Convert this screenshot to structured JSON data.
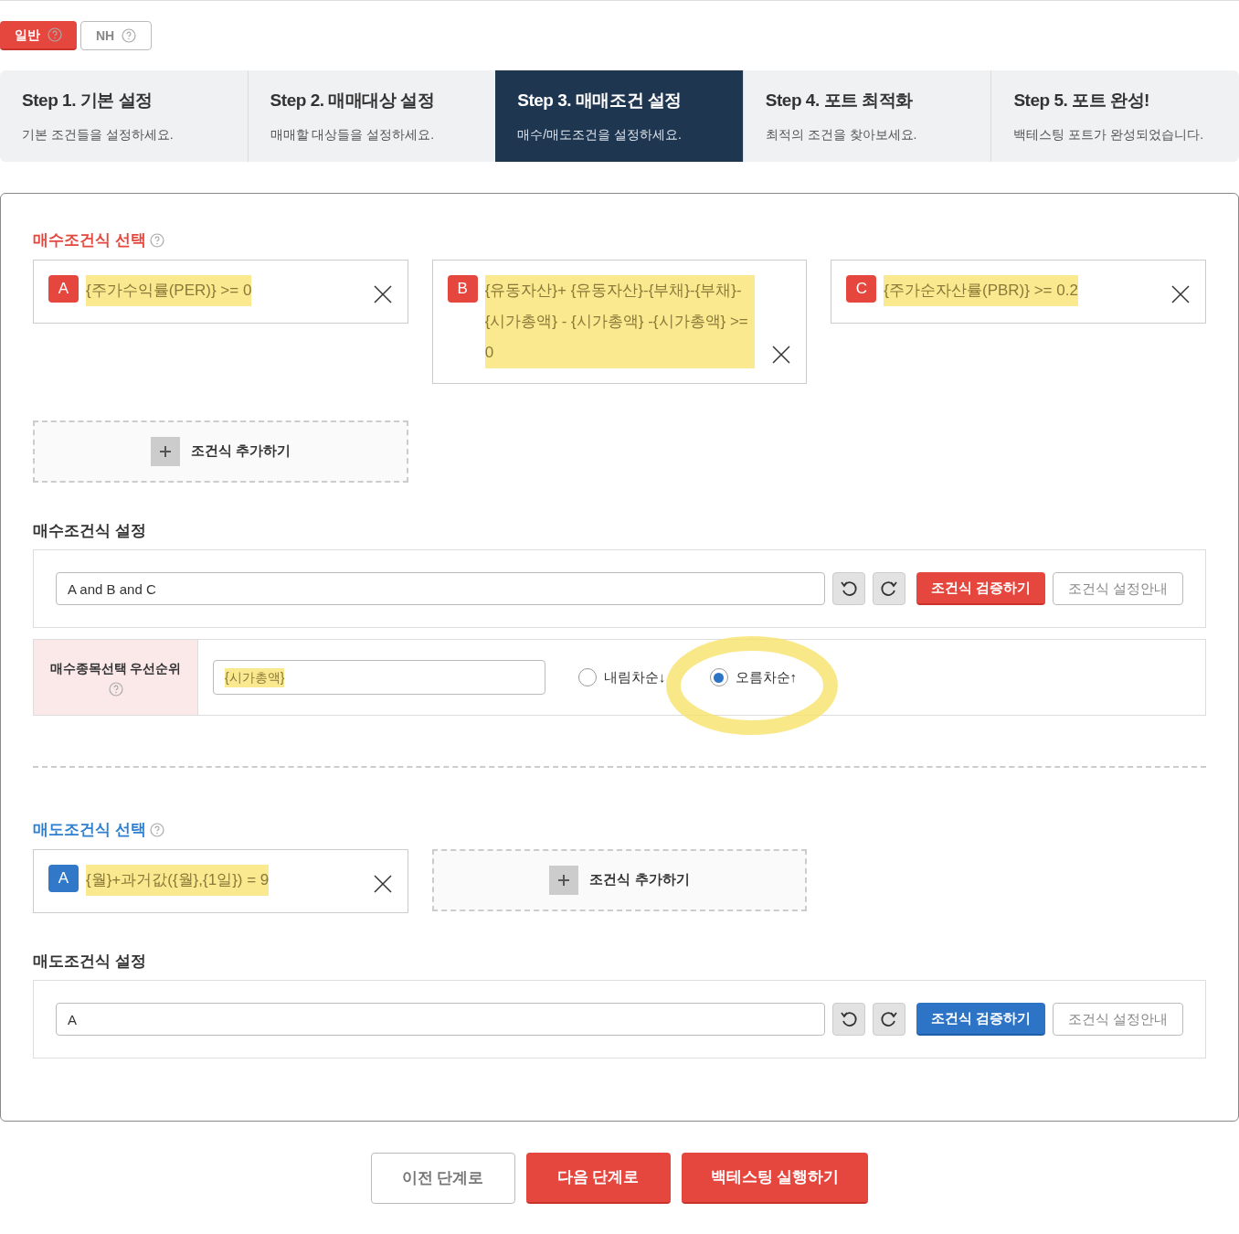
{
  "modes": [
    {
      "label": "일반",
      "selected": true
    },
    {
      "label": "NH",
      "selected": false
    }
  ],
  "steps": [
    {
      "title": "Step 1. 기본 설정",
      "subtitle": "기본 조건들을 설정하세요.",
      "selected": false
    },
    {
      "title": "Step 2. 매매대상 설정",
      "subtitle": "매매할 대상들을 설정하세요.",
      "selected": false
    },
    {
      "title": "Step 3. 매매조건 설정",
      "subtitle": "매수/매도조건을 설정하세요.",
      "selected": true
    },
    {
      "title": "Step 4. 포트 최적화",
      "subtitle": "최적의 조건을 찾아보세요.",
      "selected": false
    },
    {
      "title": "Step 5. 포트 완성!",
      "subtitle": "백테스팅 포트가 완성되었습니다.",
      "selected": false
    }
  ],
  "sections": [
    {
      "kind": "buy",
      "title": "매수조건식 선택",
      "conditions": [
        {
          "letter": "A",
          "formula": "{주가수익률(PER)} >= 0",
          "highlighted": true
        },
        {
          "letter": "B",
          "formula": "{유동자산}+ {유동자산}-{부채}-{부채}-{시가총액} - {시가총액} -{시가총액} >= 0",
          "highlighted": true
        },
        {
          "letter": "C",
          "formula": "{주가순자산률(PBR)} >= 0.2",
          "highlighted": true
        }
      ],
      "add_label": "조건식 추가하기",
      "settings_title": "매수조건식 설정",
      "expression": "A and B and C",
      "verify_label": "조건식 검증하기",
      "guide_label": "조건식 설정안내",
      "priority": {
        "label": "매수종목선택 우선순위",
        "value": "{시가총액}",
        "highlighted": true,
        "circled": true,
        "options": [
          {
            "label": "내림차순↓",
            "selected": false
          },
          {
            "label": "오름차순↑",
            "selected": true
          }
        ]
      }
    },
    {
      "kind": "sell",
      "title": "매도조건식 선택",
      "conditions": [
        {
          "letter": "A",
          "formula": "{월}+과거값({월},{1일}) = 9",
          "highlighted": true
        }
      ],
      "add_label": "조건식 추가하기",
      "settings_title": "매도조건식 설정",
      "expression": "A",
      "verify_label": "조건식 검증하기",
      "guide_label": "조건식 설정안내"
    }
  ],
  "footer": [
    {
      "label": "이전 단계로",
      "kind": "secondary"
    },
    {
      "label": "다음 단계로",
      "kind": "primary"
    },
    {
      "label": "백테스팅 실행하기",
      "kind": "primary"
    }
  ]
}
